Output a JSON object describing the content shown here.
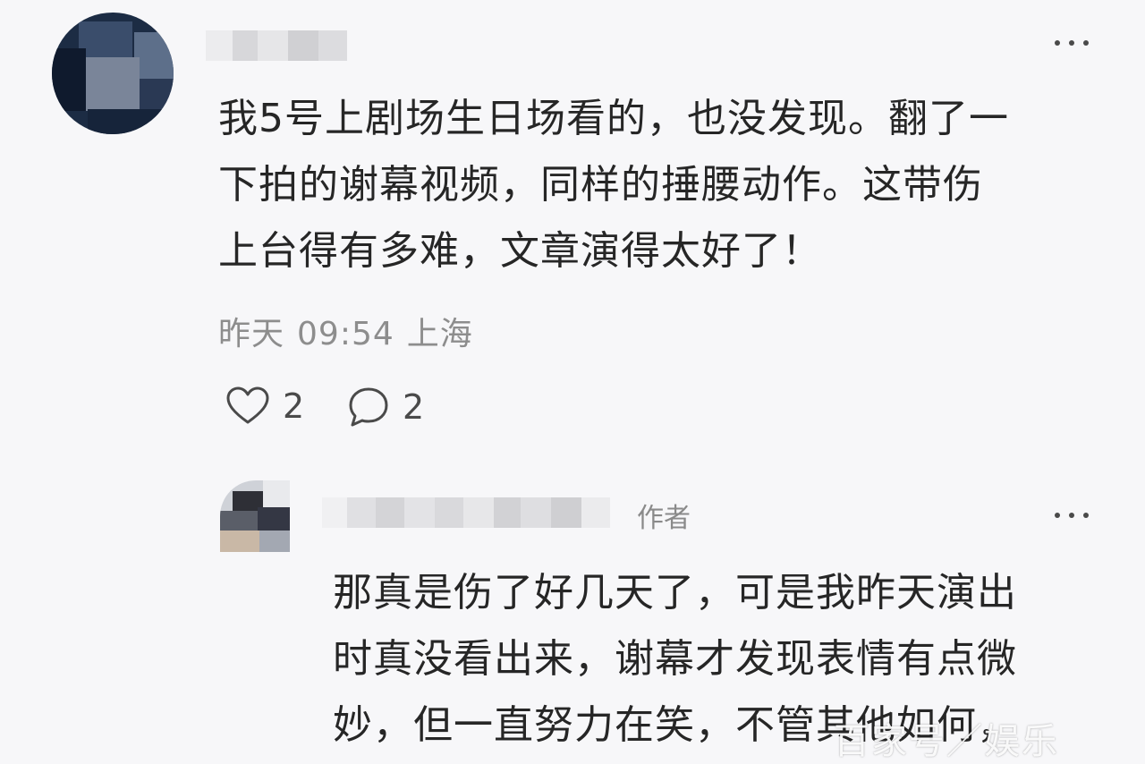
{
  "comment": {
    "text_lines": [
      "我5号上剧场生日场看的，也没发现。翻了一",
      "下拍的谢幕视频，同样的捶腰动作。这带伤",
      "上台得有多难，文章演得太好了！"
    ],
    "date": "昨天",
    "time": "09:54",
    "location": "上海",
    "like_count": "2",
    "reply_count": "2",
    "like_icon": "heart-outline",
    "reply_icon": "speech-bubble",
    "more_icon": "three-dots"
  },
  "reply": {
    "author_badge": "作者",
    "text_lines": [
      "那真是伤了好几天了，可是我昨天演出",
      "时真没看出来，谢幕才发现表情有点微",
      "妙，但一直努力在笑，不管其他如何，"
    ],
    "more_icon": "three-dots"
  },
  "watermark": "百家号／娱乐"
}
